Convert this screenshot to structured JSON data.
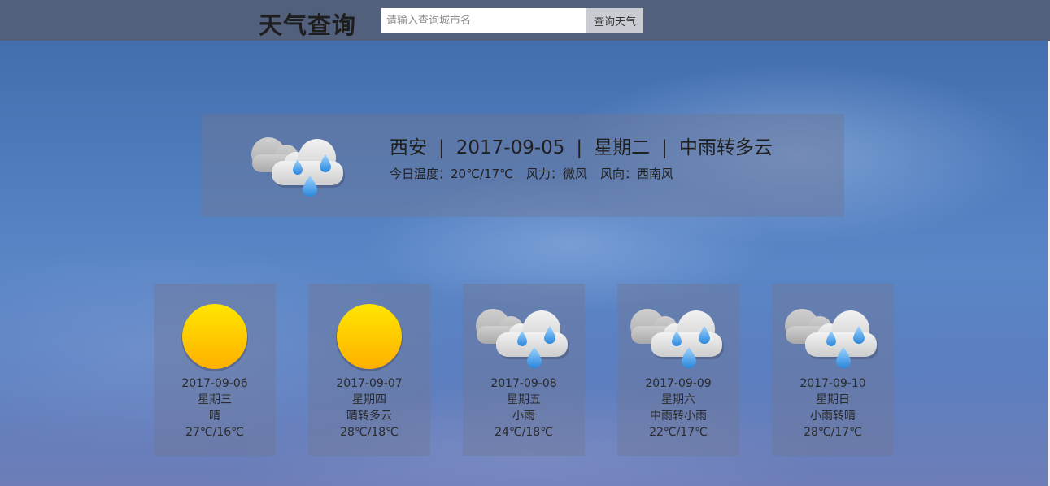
{
  "header": {
    "title": "天气查询",
    "search_placeholder": "请输入查询城市名",
    "search_value": "",
    "search_button": "查询天气"
  },
  "today": {
    "city": "西安",
    "date": "2017-09-05",
    "weekday": "星期二",
    "weather": "中雨转多云",
    "separator": "|",
    "temperature_label": "今日温度：",
    "temperature": "20℃/17℃",
    "wind_force_label": "风力：",
    "wind_force": "微风",
    "wind_direction_label": "风向：",
    "wind_direction": "西南风",
    "icon": "rain-cloud-icon"
  },
  "forecast": [
    {
      "date": "2017-09-06",
      "weekday": "星期三",
      "weather": "晴",
      "temp": "27℃/16℃",
      "icon": "sun-icon"
    },
    {
      "date": "2017-09-07",
      "weekday": "星期四",
      "weather": "晴转多云",
      "temp": "28℃/18℃",
      "icon": "sun-icon"
    },
    {
      "date": "2017-09-08",
      "weekday": "星期五",
      "weather": "小雨",
      "temp": "24℃/18℃",
      "icon": "rain-cloud-icon"
    },
    {
      "date": "2017-09-09",
      "weekday": "星期六",
      "weather": "中雨转小雨",
      "temp": "22℃/17℃",
      "icon": "rain-cloud-icon"
    },
    {
      "date": "2017-09-10",
      "weekday": "星期日",
      "weather": "小雨转晴",
      "temp": "28℃/17℃",
      "icon": "rain-cloud-icon"
    }
  ],
  "colors": {
    "topbar": "#55607a",
    "sun_top": "#ffe000",
    "sun_bottom": "#ffb300",
    "raindrop": "#3a9be8",
    "cloud_back": "#b9b9b9",
    "cloud_front": "#e2e2e2"
  }
}
